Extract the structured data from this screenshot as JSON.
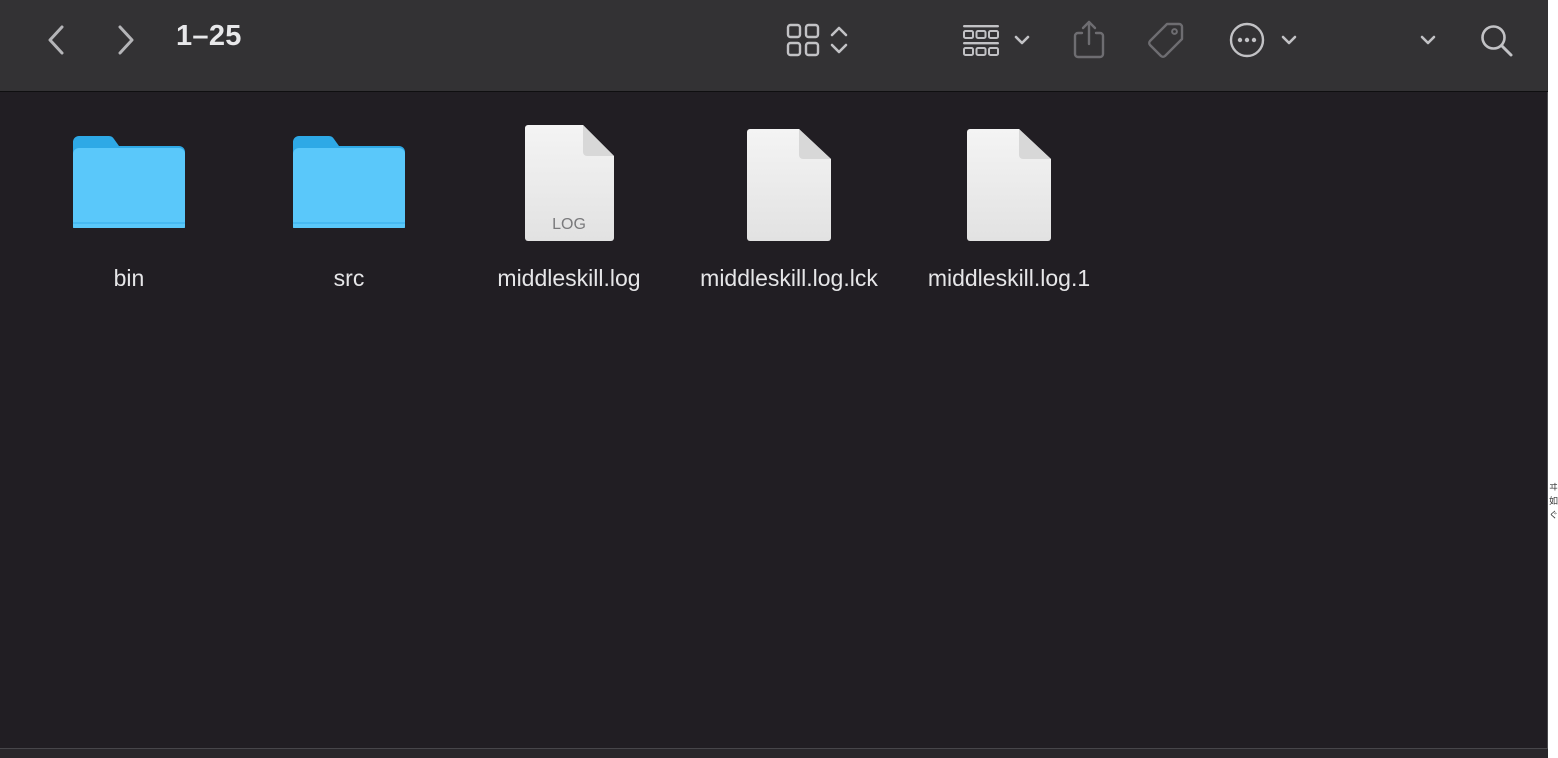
{
  "window": {
    "title": "1–25"
  },
  "toolbar": {
    "back_icon": "chevron-left-icon",
    "forward_icon": "chevron-right-icon",
    "view_icon": "grid-view-icon",
    "view_switch_icon": "up-down-chevron-icon",
    "group_icon": "group-grid-icon",
    "group_menu_icon": "chevron-down-icon",
    "share_icon": "share-icon",
    "tag_icon": "tag-icon",
    "more_icon": "ellipsis-circle-icon",
    "more_menu_icon": "chevron-down-icon",
    "expand_icon": "chevron-down-icon",
    "search_icon": "magnifier-icon"
  },
  "files": [
    {
      "name": "bin",
      "kind": "folder"
    },
    {
      "name": "src",
      "kind": "folder"
    },
    {
      "name": "middleskill.log",
      "kind": "log-document",
      "badge": "LOG"
    },
    {
      "name": "middleskill.log.lck",
      "kind": "document"
    },
    {
      "name": "middleskill.log.1",
      "kind": "document"
    }
  ],
  "colors": {
    "folder": "#5ac8fa",
    "folder_dark": "#2ea9e6",
    "toolbar_bg": "#333234",
    "content_bg": "#211e23",
    "text": "#e6e6e8"
  },
  "edge_text": "ヰ如…ぐ›"
}
